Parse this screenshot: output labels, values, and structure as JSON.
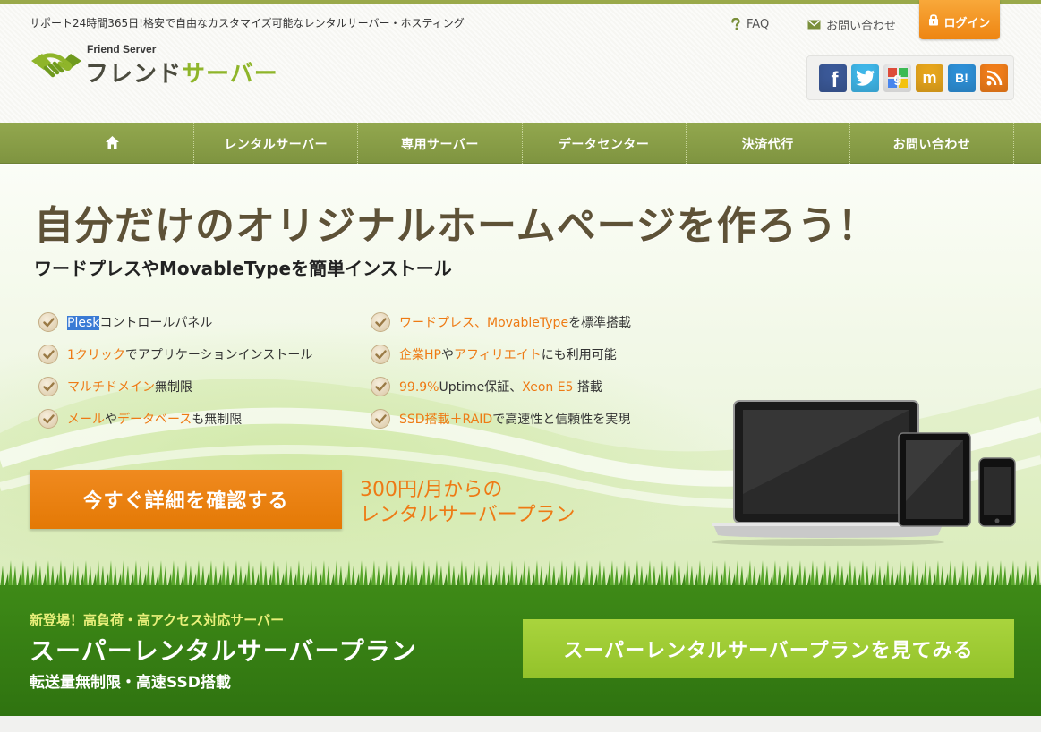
{
  "header": {
    "tagline": "サポート24時間365日!格安で自由なカスタマイズ可能なレンタルサーバー・ホスティング",
    "logo_sub": "Friend Server",
    "logo_main_1": "フレンド",
    "logo_main_2": "サーバー",
    "faq_label": "FAQ",
    "contact_label": "お問い合わせ",
    "login_label": "ログイン",
    "social": [
      {
        "icon": "facebook-icon",
        "glyph": "f",
        "color": "#3b5998"
      },
      {
        "icon": "twitter-icon",
        "glyph": "t",
        "color": "#3fb6e8"
      },
      {
        "icon": "google-icon",
        "glyph": "g",
        "color": "#e8e8e8"
      },
      {
        "icon": "mixi-icon",
        "glyph": "m",
        "color": "#e6a51c"
      },
      {
        "icon": "hatena-bookmark-icon",
        "glyph": "B!",
        "color": "#2d8fd6"
      },
      {
        "icon": "rss-icon",
        "glyph": "rss",
        "color": "#f07d1a"
      }
    ]
  },
  "nav": {
    "home_icon": "home-icon",
    "items": [
      "レンタルサーバー",
      "専用サーバー",
      "データセンター",
      "決済代行",
      "お問い合わせ"
    ]
  },
  "hero": {
    "title": "自分だけのオリジナルホームページを作ろう！",
    "subtitle": "ワードプレスやMovableTypeを簡単インストール",
    "features_left": [
      {
        "sel": "Plesk",
        "parts": [
          {
            "t": "Plesk",
            "hl": false,
            "sel": true
          },
          {
            "t": "コントロールパネル",
            "hl": false
          }
        ]
      },
      {
        "parts": [
          {
            "t": "1クリック",
            "hl": true
          },
          {
            "t": "でアプリケーションインストール",
            "hl": false
          }
        ]
      },
      {
        "parts": [
          {
            "t": "マルチドメイン",
            "hl": true
          },
          {
            "t": "無制限",
            "hl": false
          }
        ]
      },
      {
        "parts": [
          {
            "t": "メール",
            "hl": true
          },
          {
            "t": "や",
            "hl": false
          },
          {
            "t": "データベース",
            "hl": true
          },
          {
            "t": "も無制限",
            "hl": false
          }
        ]
      }
    ],
    "features_right": [
      {
        "parts": [
          {
            "t": "ワードプレス、MovableType",
            "hl": true
          },
          {
            "t": "を標準搭載",
            "hl": false
          }
        ]
      },
      {
        "parts": [
          {
            "t": "企業HP",
            "hl": true
          },
          {
            "t": "や",
            "hl": false
          },
          {
            "t": "アフィリエイト",
            "hl": true
          },
          {
            "t": "にも利用可能",
            "hl": false
          }
        ]
      },
      {
        "parts": [
          {
            "t": "99.9%",
            "hl": true
          },
          {
            "t": "Uptime保証、",
            "hl": false
          },
          {
            "t": "Xeon E5",
            "hl": true
          },
          {
            "t": " 搭載",
            "hl": false
          }
        ]
      },
      {
        "parts": [
          {
            "t": "SSD搭載＋RAID",
            "hl": true
          },
          {
            "t": "で高速性と信頼性を実現",
            "hl": false
          }
        ]
      }
    ],
    "cta_label": "今すぐ詳細を確認する",
    "price_line_1": "300円/月からの",
    "price_line_2": "レンタルサーバープラン"
  },
  "promo": {
    "kicker": "新登場！高負荷・高アクセス対応サーバー",
    "title": "スーパーレンタルサーバープラン",
    "subtitle": "転送量無制限・高速SSD搭載",
    "button_label": "スーパーレンタルサーバープランを見てみる"
  },
  "colors": {
    "accent_orange": "#ee7a14",
    "nav_green": "#8aa049",
    "promo_green": "#37801a",
    "promo_button": "#a0cd36"
  }
}
